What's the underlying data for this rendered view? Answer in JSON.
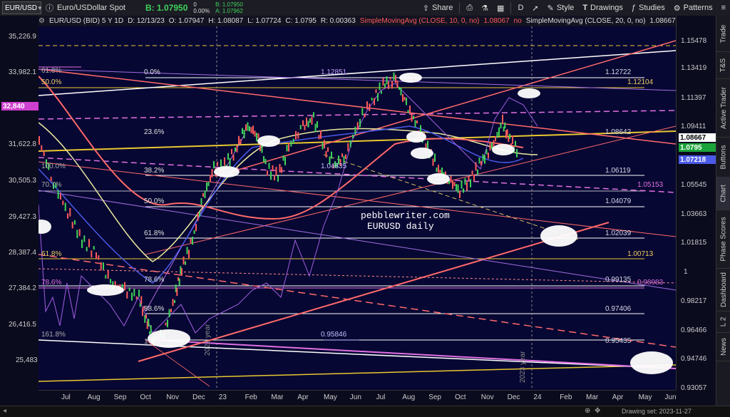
{
  "toolbar": {
    "symbol": "EUR/USD",
    "description": "Euro/USDollar Spot",
    "bid_label": "B: 1.07950",
    "change_pct": "0.00%",
    "change_val": "0",
    "bid_small": "B: 1.07950",
    "ask_small": "A: 1.07962",
    "share": "Share",
    "period": "D",
    "style": "Style",
    "drawings": "Drawings",
    "studies": "Studies",
    "patterns": "Patterns"
  },
  "infobar": {
    "title": "EUR/USD (BID) 5 Y 1D",
    "date": "D: 12/13/23",
    "open": "O: 1.07947",
    "high": "H: 1.08087",
    "low": "L: 1.07724",
    "close": "C: 1.0795",
    "range": "R: 0.00363",
    "sma10": "SimpleMovingAvg (CLOSE, 10, 0, no)",
    "sma10_val": "1.08067",
    "sma10_no": "no",
    "sma20": "SimpleMovingAvg (CLOSE, 20, 0, no)",
    "sma20_val": "1.08667"
  },
  "left_axis": [
    "35,226.9",
    "33,982.1",
    "32,840",
    "31,622.8",
    "30,505.3",
    "29,427.3",
    "28,387.4",
    "27,384.2",
    "26,416.5",
    "25,483"
  ],
  "left_tag": "32,840",
  "right_axis": [
    "1.15478",
    "1.13419",
    "1.11397",
    "1.09411",
    "1.07460",
    "1.05545",
    "1.03663",
    "1.01815",
    "1",
    "0.98217",
    "0.96466",
    "0.94746",
    "0.93057"
  ],
  "right_tags": [
    {
      "text": "1.08667",
      "bg": "#ffffff",
      "fg": "#000000"
    },
    {
      "text": "1.0795",
      "bg": "#1aa33a",
      "fg": "#ffffff"
    },
    {
      "text": "1.07218",
      "bg": "#4a5ae8",
      "fg": "#ffffff"
    }
  ],
  "x_axis": [
    "Jul",
    "Aug",
    "Sep",
    "Oct",
    "Nov",
    "Dec",
    "23",
    "Feb",
    "Mar",
    "Apr",
    "May",
    "Jun",
    "Jul",
    "Aug",
    "Sep",
    "Oct",
    "Nov",
    "Dec",
    "24",
    "Feb",
    "Mar",
    "Apr",
    "May",
    "Jun"
  ],
  "fib_labels": [
    "0.0%",
    "23.6%",
    "38.2%",
    "50.0%",
    "61.8%",
    "78.6%",
    "88.6%",
    "61.8%",
    "50.0%",
    "100.0%",
    "70.7%",
    "61.8%",
    "78.6%",
    "161.8%",
    "1"
  ],
  "levels": [
    {
      "text": "1.12722",
      "color": "#ffffff"
    },
    {
      "text": "1.12104",
      "color": "#f0d060"
    },
    {
      "text": "1.08642",
      "color": "#ffffff"
    },
    {
      "text": "1.06119",
      "color": "#ffffff"
    },
    {
      "text": "1.05153",
      "color": "#e070e0"
    },
    {
      "text": "1.04079",
      "color": "#ffffff"
    },
    {
      "text": "1.02039",
      "color": "#ffffff"
    },
    {
      "text": "1.00713",
      "color": "#f0d060"
    },
    {
      "text": "0.99135",
      "color": "#ffffff"
    },
    {
      "text": "0.98983",
      "color": "#e070e0"
    },
    {
      "text": "0.97406",
      "color": "#ffffff"
    },
    {
      "text": "0.95435",
      "color": "#ffffff"
    },
    {
      "text": "1.12851",
      "color": "#c0a0ff"
    },
    {
      "text": "1.04835",
      "color": "#c0c0ff"
    },
    {
      "text": "0.95846",
      "color": "#c0c0ff"
    }
  ],
  "watermark": {
    "line1": "pebblewriter.com",
    "line2": "EURUSD daily"
  },
  "year_labels": [
    "2022 year",
    "2023 year"
  ],
  "sidebar_tabs": [
    "Trade",
    "T&S",
    "Active Trader",
    "Buttons",
    "Chart",
    "Phase Scores",
    "Dashboard",
    "L 2",
    "News"
  ],
  "status": {
    "drawing_set": "Drawing set: 2023-11-27"
  },
  "colors": {
    "background": "#070733",
    "up": "#3fd25a",
    "down": "#ff5a5a",
    "accent": "#e8c830"
  }
}
